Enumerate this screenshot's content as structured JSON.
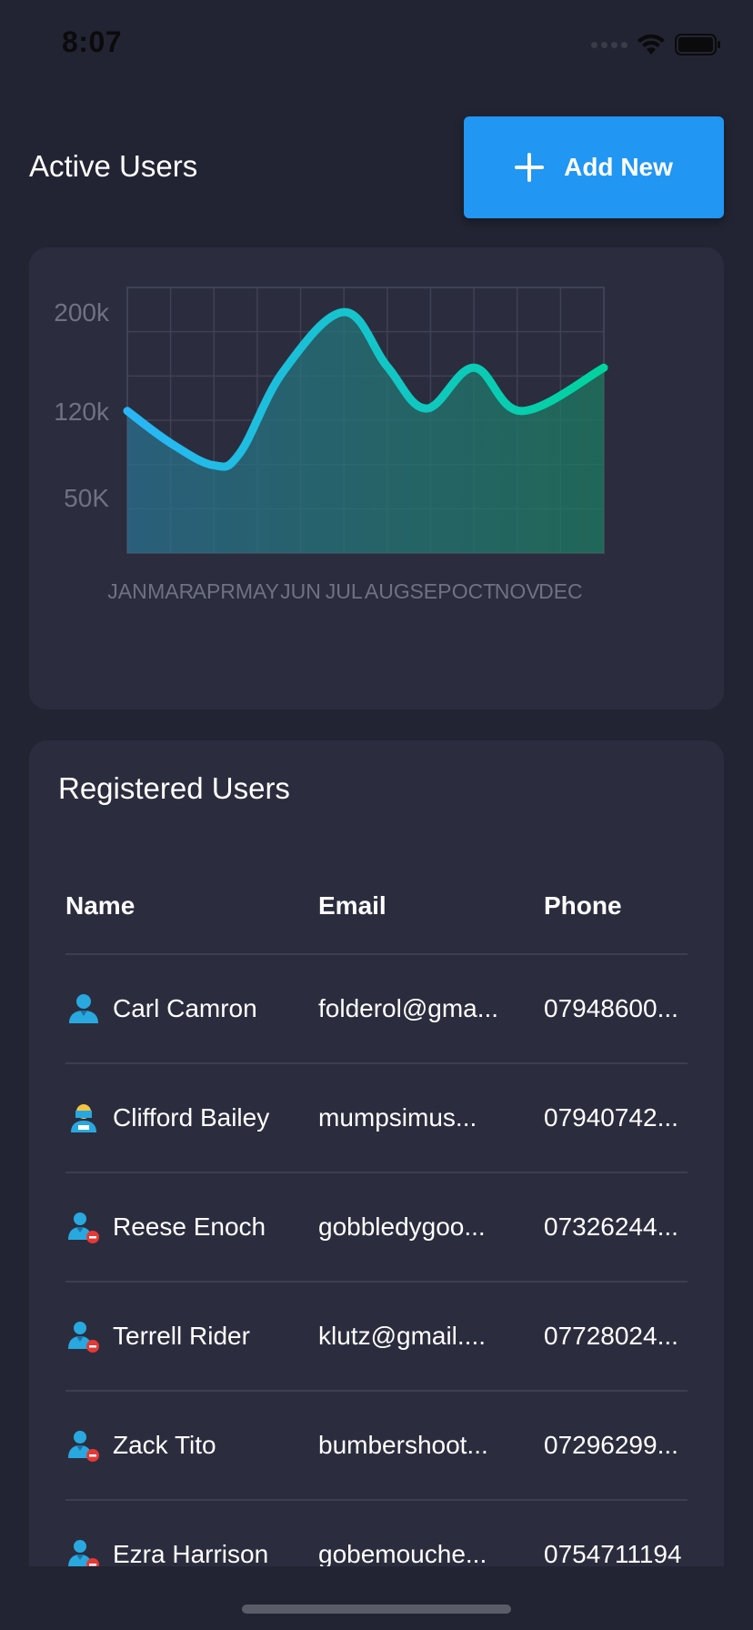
{
  "status_bar": {
    "time": "8:07"
  },
  "header": {
    "title": "Active Users",
    "add_button_label": "Add New"
  },
  "chart_data": {
    "type": "area",
    "categories": [
      "JAN",
      "MAR",
      "APR",
      "MAY",
      "JUN",
      "JUL",
      "AUG",
      "SEP",
      "OCT",
      "NOV",
      "DEC"
    ],
    "x": [
      0,
      1,
      2,
      2.6,
      3.6,
      5,
      6,
      6.9,
      8,
      9.1,
      11
    ],
    "values": [
      120,
      94,
      76,
      86,
      152,
      200,
      156,
      122,
      155,
      120,
      155
    ],
    "y_tick_labels": [
      "200k",
      "120k",
      "50K"
    ],
    "y_tick_values": [
      200,
      120,
      50
    ],
    "ylim": [
      5,
      220
    ],
    "grid": true,
    "colors": {
      "line_start": "#29b6f6",
      "line_end": "#00d39e",
      "fill_start": "#2a6f8e",
      "fill_end": "#1d7a60"
    }
  },
  "users": {
    "title": "Registered Users",
    "columns": {
      "name": "Name",
      "email": "Email",
      "phone": "Phone"
    },
    "rows": [
      {
        "icon": "user-icon",
        "name": "Carl Camron",
        "email": "folderol@gma...",
        "phone": "07948600..."
      },
      {
        "icon": "user-helmet-icon",
        "name": "Clifford Bailey",
        "email": "mumpsimus...",
        "phone": "07940742..."
      },
      {
        "icon": "user-remove-icon",
        "name": "Reese Enoch",
        "email": "gobbledygoo...",
        "phone": "07326244..."
      },
      {
        "icon": "user-remove-icon",
        "name": "Terrell Rider",
        "email": "klutz@gmail....",
        "phone": "07728024..."
      },
      {
        "icon": "user-remove-icon",
        "name": "Zack Tito",
        "email": "bumbershoot...",
        "phone": "07296299..."
      },
      {
        "icon": "user-remove-icon",
        "name": "Ezra Harrison",
        "email": "gobemouche...",
        "phone": "0754711194"
      }
    ]
  },
  "colors": {
    "background": "#222433",
    "card": "#2b2d3e",
    "accent": "#2196f3",
    "remove_badge": "#e53935"
  }
}
